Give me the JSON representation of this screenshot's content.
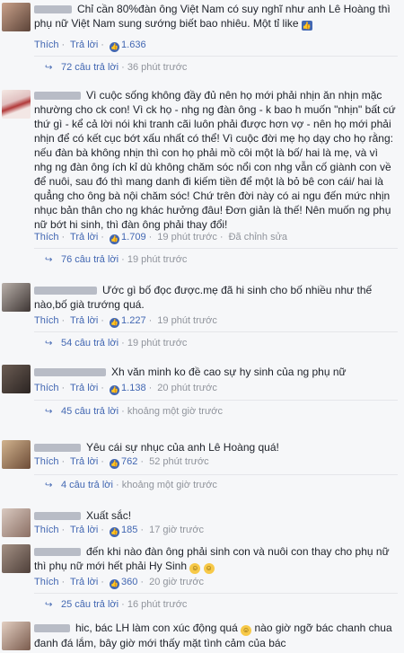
{
  "comments": [
    {
      "text": "Chỉ cần 80%đàn ông Việt Nam có suy nghĩ như anh Lê Hoàng thì phụ nữ Việt Nam sung sướng biết bao nhiêu. Một tỉ like",
      "like_label": "Thích",
      "reply_label": "Trả lời",
      "likes": "1.636",
      "time": "36 phút trước",
      "replies": "72 câu trả lời",
      "replies_time": "36 phút trước"
    },
    {
      "text": "Vì cuộc sống không đầy đủ nên họ mới phải nhịn ăn nhịn mặc nhường cho ck con! Vì ck họ - nhg ng đàn ông - k bao h muốn \"nhịn\" bất cứ thứ gì - kể cả lời nói khi tranh cãi luôn phải được hơn vợ - nên họ mới phải nhịn để có kết cục bớt xấu nhất có thể! Vì cuộc đời mẹ họ dạy cho họ rằng: nếu đàn bà không nhịn thì con họ phải mồ côi một là bố/ hai là mẹ, và vì nhg ng đàn ông ích kỉ dù không chăm sóc nổi con nhg vẫn cố giành con về để nuôi, sau đó thì mang danh đi kiếm tiền để một là bỏ bê con cái/ hai là quẳng cho ông bà nội chăm sóc! Chứ trên đời này có ai ngu đến mức nhịn nhục bản thân cho ng khác hưởng đâu! Đơn giản là thế! Nên muốn ng phụ nữ bớt hi sinh, thì đàn ông phải thay đổi!",
      "like_label": "Thích",
      "reply_label": "Trả lời",
      "likes": "1.709",
      "time": "19 phút trước",
      "edited": "Đã chỉnh sửa",
      "replies": "76 câu trả lời",
      "replies_time": "19 phút trước"
    },
    {
      "text": "Ước gì bố đọc được.mẹ đã hi sinh cho bố nhiều như thế nào,bố già trướng quá.",
      "like_label": "Thích",
      "reply_label": "Trả lời",
      "likes": "1.227",
      "time": "19 phút trước",
      "replies": "54 câu trả lời",
      "replies_time": "19 phút trước"
    },
    {
      "text": "Xh văn minh ko đề cao sự hy sinh của ng phụ nữ",
      "like_label": "Thích",
      "reply_label": "Trả lời",
      "likes": "1.138",
      "time": "20 phút trước",
      "replies": "45 câu trả lời",
      "replies_time": "khoảng một giờ trước"
    },
    {
      "text": "Yêu cái sự nhục của anh Lê Hoàng quá!",
      "like_label": "Thích",
      "reply_label": "Trả lời",
      "likes": "762",
      "time": "52 phút trước",
      "replies": "4 câu trả lời",
      "replies_time": "khoảng một giờ trước"
    },
    {
      "text": "Xuất sắc!",
      "like_label": "Thích",
      "reply_label": "Trả lời",
      "likes": "185",
      "time": "17 giờ trước"
    },
    {
      "text": "đến khi nào đàn ông phải sinh con và nuôi con thay cho phụ nữ thì phụ nữ mới hết phải Hy Sinh",
      "like_label": "Thích",
      "reply_label": "Trả lời",
      "likes": "360",
      "time": "20 giờ trước",
      "replies": "25 câu trả lời",
      "replies_time": "16 phút trước"
    },
    {
      "text": "hic, bác LH làm con xúc động quá",
      "text2": "nào giờ ngỡ bác chanh chua đanh đá lắm, bây giờ mới thấy mặt tình cảm của bác"
    }
  ],
  "icons": {
    "like": "thumbs-up-icon",
    "reply_arrow": "reply-arrow-icon",
    "smile": "smile-emoji-icon",
    "laugh": "laughing-emoji-icon"
  }
}
